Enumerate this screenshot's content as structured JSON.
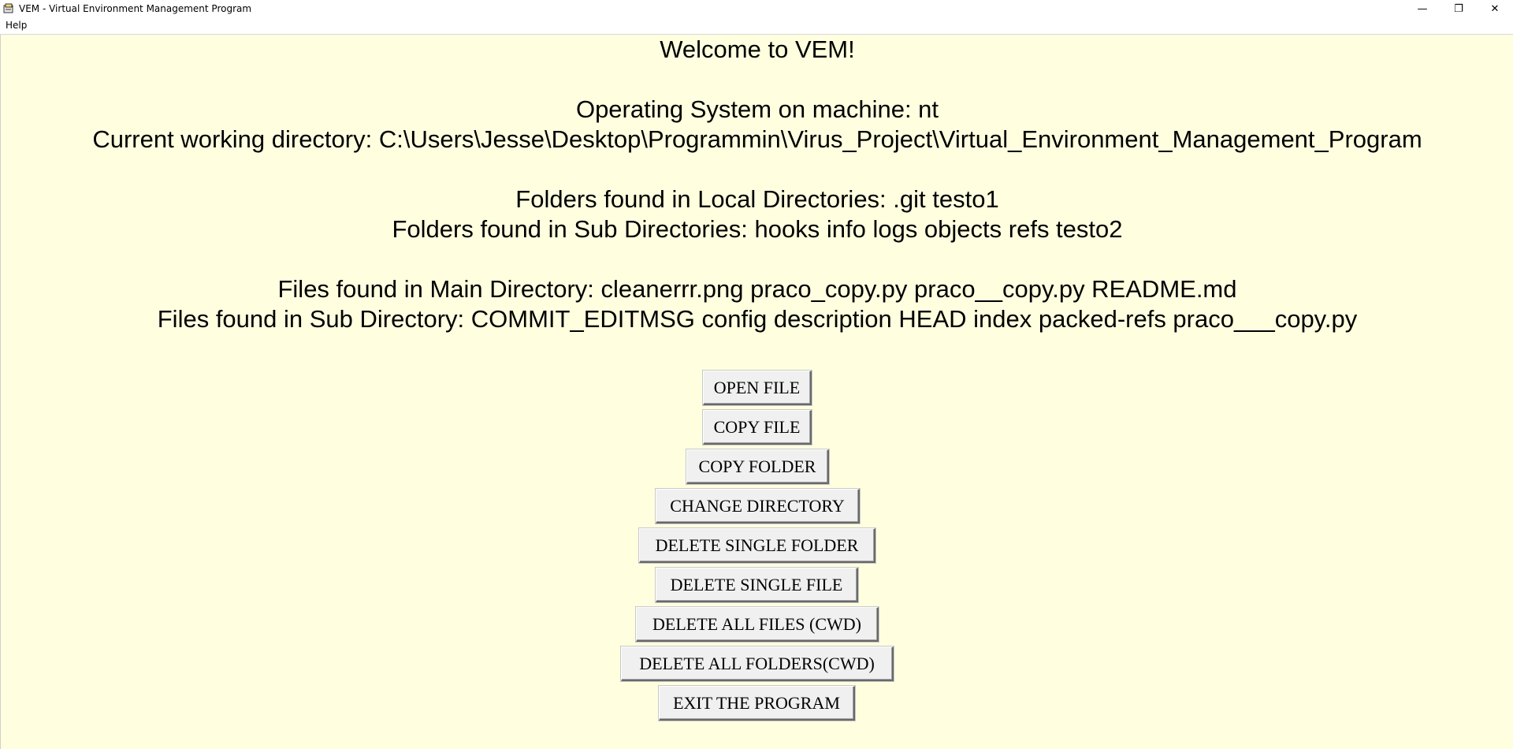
{
  "window": {
    "title": "VEM - Virtual Environment Management Program",
    "icon": "app-icon",
    "controls": {
      "minimize": "—",
      "restore": "❐",
      "close": "✕"
    }
  },
  "menubar": {
    "items": [
      "Help"
    ]
  },
  "main": {
    "background": "#ffffe0",
    "welcome": "Welcome to VEM!",
    "os_line": "Operating System on machine: nt",
    "cwd_line": "Current working directory: C:\\Users\\Jesse\\Desktop\\Programmin\\Virus_Project\\Virtual_Environment_Management_Program",
    "local_folders_line": "Folders found in Local Directories: .git testo1",
    "sub_folders_line": "Folders found in Sub Directories: hooks info logs objects refs testo2",
    "main_files_line": "Files found in Main Directory: cleanerrr.png praco_copy.py praco__copy.py README.md",
    "sub_files_line": "Files found in Sub Directory: COMMIT_EDITMSG config description HEAD index packed-refs praco___copy.py"
  },
  "buttons": {
    "open_file": "OPEN FILE",
    "copy_file": "COPY FILE",
    "copy_folder": "COPY FOLDER",
    "change_directory": "CHANGE DIRECTORY",
    "delete_single_folder": "DELETE SINGLE FOLDER",
    "delete_single_file": "DELETE SINGLE FILE",
    "delete_all_files": "DELETE ALL FILES (CWD)",
    "delete_all_folders": "DELETE ALL FOLDERS(CWD)",
    "exit": "EXIT THE PROGRAM"
  }
}
